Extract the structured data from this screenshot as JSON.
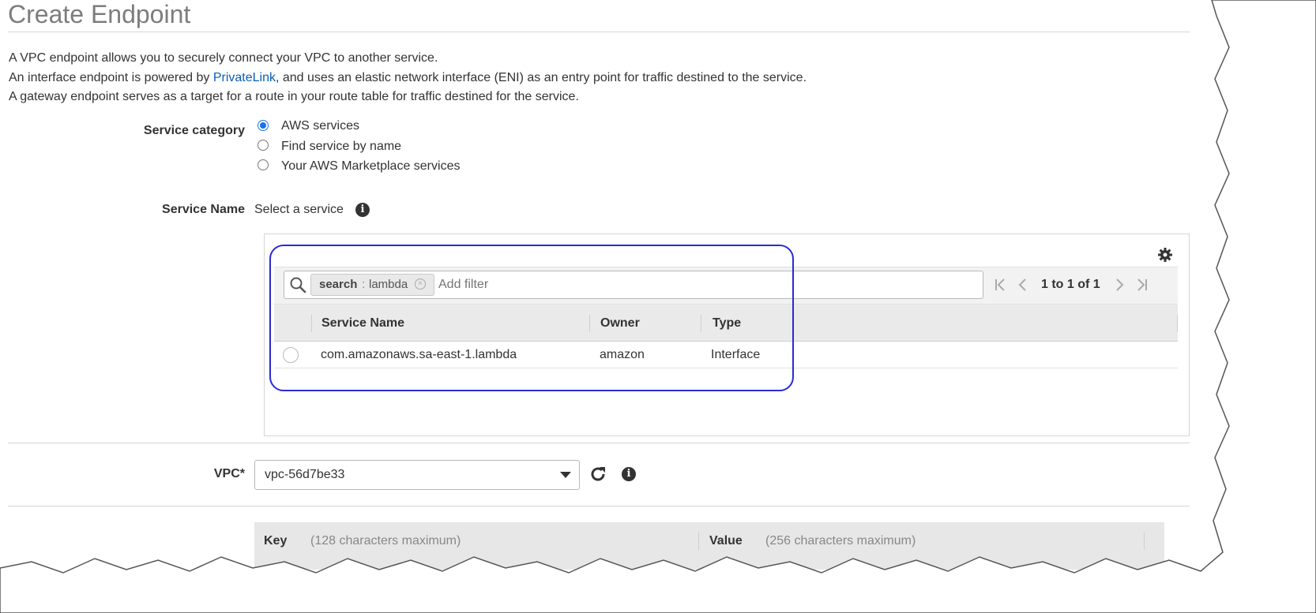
{
  "page": {
    "title": "Create Endpoint",
    "intro": {
      "line1": "A VPC endpoint allows you to securely connect your VPC to another service.",
      "line2_before": "An interface endpoint is powered by ",
      "line2_link": "PrivateLink",
      "line2_after": ", and uses an elastic network interface (ENI) as an entry point for traffic destined to the service.",
      "line3": "A gateway endpoint serves as a target for a route in your route table for traffic destined for the service."
    }
  },
  "service_category": {
    "label": "Service category",
    "options": [
      {
        "label": "AWS services",
        "selected": true
      },
      {
        "label": "Find service by name",
        "selected": false
      },
      {
        "label": "Your AWS Marketplace services",
        "selected": false
      }
    ]
  },
  "service_name": {
    "label": "Service Name",
    "prompt": "Select a service"
  },
  "table": {
    "filter_token_key": "search",
    "filter_token_sep": " : ",
    "filter_token_value": "lambda",
    "filter_placeholder": "Add filter",
    "pagination": "1 to 1 of 1",
    "columns": [
      "Service Name",
      "Owner",
      "Type"
    ],
    "rows": [
      {
        "service_name": "com.amazonaws.sa-east-1.lambda",
        "owner": "amazon",
        "type": "Interface"
      }
    ]
  },
  "vpc": {
    "label": "VPC*",
    "value": "vpc-56d7be33"
  },
  "tags": {
    "key_label": "Key",
    "key_hint": "(128 characters maximum)",
    "value_label": "Value",
    "value_hint": "(256 characters maximum)"
  },
  "colors": {
    "link": "#0a5fb4",
    "highlight_border": "#2a2ad6",
    "radio_selected": "#1a73e8"
  }
}
